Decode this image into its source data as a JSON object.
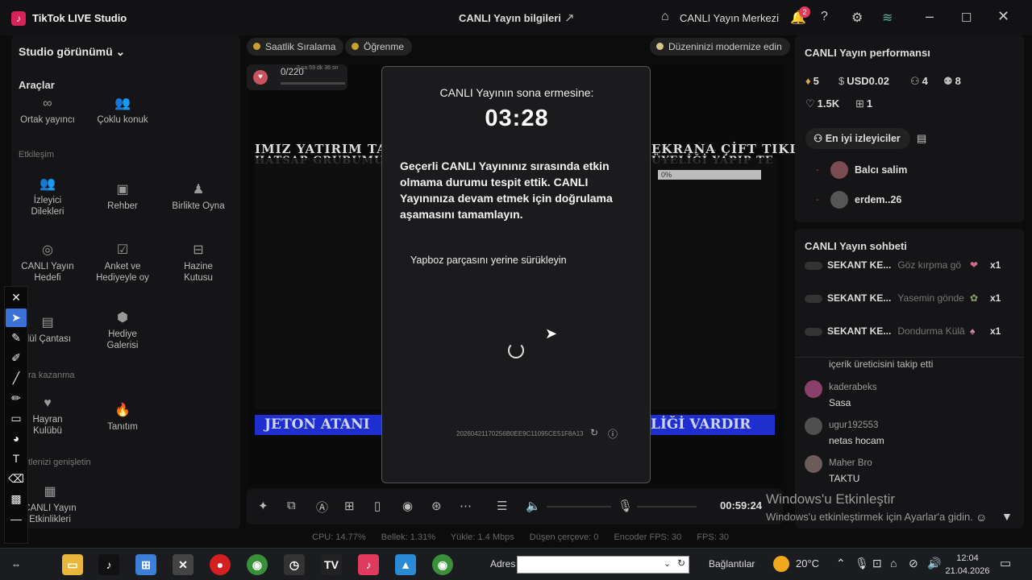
{
  "app": {
    "name": "TikTok LIVE Studio",
    "logo": "♪"
  },
  "header": {
    "center_title": "CANLI Yayın bilgileri",
    "live_center": "CANLI Yayın Merkezi",
    "notif_count": "2"
  },
  "sidebar": {
    "studio_view": "Studio görünümü",
    "tools_heading": "Araçlar",
    "tools": [
      {
        "label": "Ortak yayıncı",
        "icon": "∞"
      },
      {
        "label": "Çoklu konuk",
        "icon": "👥"
      }
    ],
    "interaction_heading": "Etkileşim",
    "interaction": [
      {
        "l1": "İzleyici",
        "l2": "Dilekleri"
      },
      {
        "l1": "Rehber",
        "l2": ""
      },
      {
        "l1": "Birlikte Oyna",
        "l2": ""
      },
      {
        "l1": "CANLI Yayın",
        "l2": "Hedefi"
      },
      {
        "l1": "Anket ve",
        "l2": "Hediyeyle oy"
      },
      {
        "l1": "Hazine",
        "l2": "Kutusu"
      },
      {
        "l1": "dül Çantası",
        "l2": ""
      },
      {
        "l1": "Hediye",
        "l2": "Galerisi"
      }
    ],
    "earn_heading": "ra kazanma",
    "earn": [
      {
        "l1": "Hayran",
        "l2": "Kulübü"
      },
      {
        "l1": "Tanıtım",
        "l2": ""
      }
    ],
    "expand_heading": "tlenizi genişletin",
    "expand": [
      {
        "l1": "CANLI Yayın",
        "l2": "Etkinlikleri"
      }
    ]
  },
  "chips": {
    "ranking": "Saatlik Sıralama",
    "learning": "Öğrenme",
    "modernize": "Düzeninizi modernize edin"
  },
  "counter": {
    "value": "0/220",
    "timer": "3 sa 59 dk 36 sn"
  },
  "preview": {
    "banner_left": "IMIZ YATIRIM TAVS",
    "banner_left2": "HATSAP GRUBUMUZ",
    "banner_right": "EKRANA ÇİFT TIKL",
    "banner_right2": "ÜYELİĞİ YAPIP TE",
    "bottom_left": "JETON ATANI",
    "bottom_right": "LİĞİ VARDIR",
    "progress": "0%"
  },
  "modal": {
    "title": "CANLI Yayının sona ermesine:",
    "timer": "03:28",
    "body": "Geçerli CANLI Yayınınız sırasında etkin olmama durumu tespit ettik. CANLI Yayınınıza devam etmek için doğrulama aşamasını tamamlayın.",
    "puzzle": "Yapboz parçasını yerine sürükleyin",
    "captcha_id": "20260421170256B0EE9C11095CE51F8A13"
  },
  "controls": {
    "live_time": "00:59:24"
  },
  "stats": {
    "cpu": "CPU: 14.77%",
    "memory": "Bellek: 1.31%",
    "upload": "Yükle: 1.4 Mbps",
    "dropped": "Düşen çerçeve: 0",
    "encoder": "Encoder FPS: 30",
    "fps": "FPS: 30"
  },
  "performance": {
    "title": "CANLI Yayın performansı",
    "diamonds": "5",
    "usd": "USD0.02",
    "viewers": "4",
    "followers": "8",
    "likes": "1.5K",
    "gifts": "1",
    "top_viewers": "En iyi izleyiciler",
    "viewers_list": [
      "Balcı salim",
      "erdem..26"
    ]
  },
  "chat": {
    "title": "CANLI Yayın sohbeti",
    "gifts": [
      {
        "user": "SEKANT KE...",
        "text": "Göz kırpma gö",
        "count": "x1"
      },
      {
        "user": "SEKANT KE...",
        "text": "Yasemin gönde",
        "count": "x1"
      },
      {
        "user": "SEKANT KE...",
        "text": "Dondurma Külâ",
        "count": "x1"
      }
    ],
    "follow_note": "içerik üreticisini takip etti",
    "messages": [
      {
        "user": "kaderabeks",
        "text": "Sasa"
      },
      {
        "user": "ugur192553",
        "text": "netas hocam"
      },
      {
        "user": "Maher Bro",
        "text": "TAKTU"
      }
    ]
  },
  "watermark": {
    "line1": "Windows'u Etkinleştir",
    "line2": "Windows'u etkinleştirmek için Ayarlar'a gidin."
  },
  "taskbar": {
    "address_label": "Adres",
    "connections": "Bağlantılar",
    "temperature": "20°C",
    "time": "12:04",
    "date": "21.04.2026"
  }
}
